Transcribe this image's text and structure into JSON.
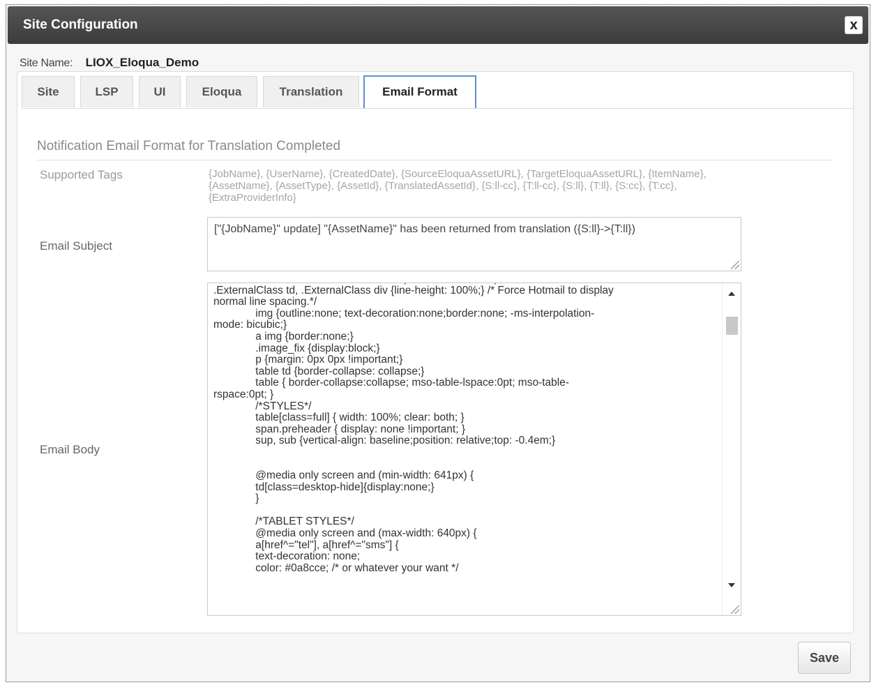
{
  "dialog": {
    "title": "Site Configuration",
    "close_label": "x"
  },
  "site": {
    "label": "Site Name:",
    "value": "LIOX_Eloqua_Demo"
  },
  "tabs": [
    {
      "label": "Site"
    },
    {
      "label": "LSP"
    },
    {
      "label": "UI"
    },
    {
      "label": "Eloqua"
    },
    {
      "label": "Translation"
    },
    {
      "label": "Email Format",
      "active": true
    }
  ],
  "email_format": {
    "section_title": "Notification Email Format for Translation Completed",
    "supported_tags_label": "Supported Tags",
    "supported_tags": "{JobName}, {UserName}, {CreatedDate}, {SourceEloquaAssetURL}, {TargetEloquaAssetURL}, {ItemName}, {AssetName}, {AssetType}, {AssetId}, {TranslatedAssetId}, {S:ll-cc}, {T:ll-cc}, {S:ll}, {T:ll}, {S:cc}, {T:cc}, {ExtraProviderInfo}",
    "subject_label": "Email Subject",
    "subject_value": "[\"{JobName}\" update] \"{AssetName}\" has been returned from translation ({S:ll}->{T:ll})",
    "body_label": "Email Body",
    "body_value": "              .ExternalClass, .ExternalClass p, .ExternalClass span, .ExternalClass font,\n.ExternalClass td, .ExternalClass div {line-height: 100%;} /* Force Hotmail to display\nnormal line spacing.*/\n              img {outline:none; text-decoration:none;border:none; -ms-interpolation-\nmode: bicubic;}\n              a img {border:none;}\n              .image_fix {display:block;}\n              p {margin: 0px 0px !important;}\n              table td {border-collapse: collapse;}\n              table { border-collapse:collapse; mso-table-lspace:0pt; mso-table-\nrspace:0pt; }\n              /*STYLES*/\n              table[class=full] { width: 100%; clear: both; }\n              span.preheader { display: none !important; }\n              sup, sub {vertical-align: baseline;position: relative;top: -0.4em;}\n\n\n              @media only screen and (min-width: 641px) {\n              td[class=desktop-hide]{display:none;}\n              }\n\n              /*TABLET STYLES*/\n              @media only screen and (max-width: 640px) {\n              a[href^=\"tel\"], a[href^=\"sms\"] {\n              text-decoration: none;\n              color: #0a8cce; /* or whatever your want */"
  },
  "footer": {
    "save_label": "Save"
  },
  "colors": {
    "titlebar": "#444444",
    "active_tab_border": "#5b8fd6"
  }
}
